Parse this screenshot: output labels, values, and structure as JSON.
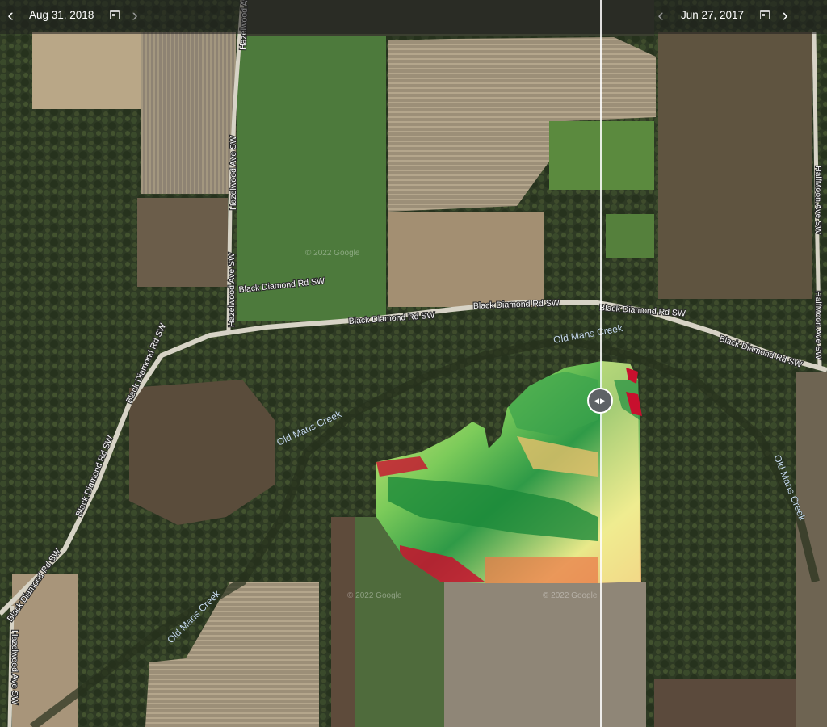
{
  "left_date": {
    "value": "Aug 31, 2018",
    "prev_icon": "chevron-left-icon",
    "next_icon": "chevron-right-icon",
    "calendar_icon": "calendar-icon"
  },
  "right_date": {
    "value": "Jun 27, 2017",
    "prev_icon": "chevron-left-icon",
    "next_icon": "chevron-right-icon",
    "calendar_icon": "calendar-icon"
  },
  "roads": {
    "black_diamond": "Black Diamond Rd SW",
    "hazelwood": "Hazelwood Ave SW",
    "halfmoon": "HalfMoon Ave SW"
  },
  "creek": "Old Mans Creek",
  "watermark": "© 2022 Google",
  "compare_handle_icon": "left-right-arrows-icon",
  "colors": {
    "ndvi_low": "#c8102e",
    "ndvi_mid": "#f5f08a",
    "ndvi_high": "#0a8a3a"
  }
}
